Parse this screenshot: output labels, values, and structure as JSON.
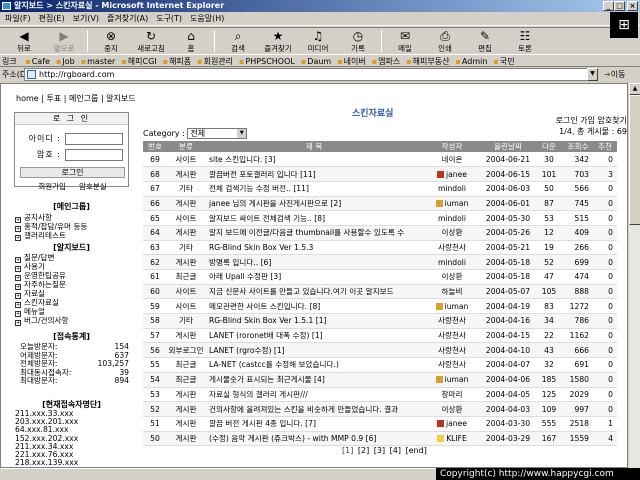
{
  "window": {
    "title": "알지보드 > 스킨자료실 - Microsoft Internet Explorer",
    "min": "_",
    "max": "□",
    "close": "×"
  },
  "menubar": [
    "파일(F)",
    "편집(E)",
    "보기(V)",
    "즐겨찾기(A)",
    "도구(T)",
    "도움말(H)"
  ],
  "toolbar": [
    {
      "label": "뒤로",
      "icon": "back-arrow-icon",
      "glyph": "◀",
      "disabled": false
    },
    {
      "label": "앞으로",
      "icon": "forward-arrow-icon",
      "glyph": "▶",
      "disabled": true
    },
    {
      "label": "중지",
      "icon": "stop-icon",
      "glyph": "⊗",
      "disabled": false
    },
    {
      "label": "새로고침",
      "icon": "refresh-icon",
      "glyph": "↻",
      "disabled": false
    },
    {
      "label": "홈",
      "icon": "home-icon",
      "glyph": "⌂",
      "disabled": false
    },
    {
      "label": "검색",
      "icon": "search-icon",
      "glyph": "⌕",
      "disabled": false
    },
    {
      "label": "즐겨찾기",
      "icon": "favorites-icon",
      "glyph": "★",
      "disabled": false
    },
    {
      "label": "미디어",
      "icon": "media-icon",
      "glyph": "♫",
      "disabled": false
    },
    {
      "label": "기록",
      "icon": "history-icon",
      "glyph": "◷",
      "disabled": false
    },
    {
      "label": "메일",
      "icon": "mail-icon",
      "glyph": "✉",
      "disabled": false
    },
    {
      "label": "인쇄",
      "icon": "print-icon",
      "glyph": "⎙",
      "disabled": false
    },
    {
      "label": "편집",
      "icon": "edit-icon",
      "glyph": "✎",
      "disabled": false
    },
    {
      "label": "토론",
      "icon": "discuss-icon",
      "glyph": "☷",
      "disabled": false
    }
  ],
  "links": [
    "Cafe",
    "Job",
    "master",
    "해피CGI",
    "해피폼",
    "회원관리",
    "PHPSCHOOL",
    "Daum",
    "네이버",
    "엠파스",
    "해피부동산",
    "Admin",
    "국민"
  ],
  "address": {
    "label": "주소(D)",
    "url": "http://rgboard.com",
    "go": "이동"
  },
  "breadcrumb": "home | 투표 | 메인그룹 | 알지보드",
  "page_title": "스킨자료실",
  "login": {
    "header": "로 그 인",
    "id_label": "아이디 :",
    "pw_label": "암호 :",
    "button": "로그인",
    "join": "회원가입",
    "find": "암호분실"
  },
  "right_links": {
    "line1": "로그인 가입 암호찾기",
    "line2": "1/4, 총 게시물 : 69"
  },
  "category": {
    "label": "Category :",
    "value": "전체"
  },
  "main_group": {
    "header": "[메인그룹]",
    "items": [
      "공지사항",
      "홍적/잡담/유머 등등",
      "갤러리테스트"
    ]
  },
  "rg_board": {
    "header": "[알지보드]",
    "items": [
      "질문/답변",
      "사용기",
      "운영한팁공유",
      "자주하는질문",
      "자료실",
      "스킨자료실",
      "메뉴얼",
      "버그/건의사항"
    ]
  },
  "stats": {
    "header": "[접속통계]",
    "rows": [
      {
        "k": "오늘방문자:",
        "v": "154"
      },
      {
        "k": "어제방문자:",
        "v": "637"
      },
      {
        "k": "전체방문자:",
        "v": "103,257"
      },
      {
        "k": "최대동시접속자:",
        "v": "39"
      },
      {
        "k": "최대방문자:",
        "v": "894"
      }
    ]
  },
  "ips": {
    "header": "[현재접속자명단]",
    "items": [
      "211.xxx.33.xxx",
      "203.xxx.201.xxx",
      "64.xxx.81.xxx",
      "152.xxx.202.xxx",
      "211.xxx.34.xxx",
      "221.xxx.76.xxx",
      "218.xxx.139.xxx"
    ]
  },
  "table": {
    "headers": [
      "번호",
      "분류",
      "제 목",
      "작성자",
      "올린날짜",
      "다운",
      "조회수",
      "추천"
    ],
    "rows": [
      [
        "69",
        "사이트",
        "site 스킨입니다. [3]",
        "네이온",
        "2004-06-21",
        "30",
        "342",
        "0"
      ],
      [
        "68",
        "게시판",
        "깔끔버전 포토갤러리 입니다 [11]",
        "janee",
        "2004-06-15",
        "101",
        "703",
        "3"
      ],
      [
        "67",
        "기타",
        "전체 검색기능 수정 버전.. [11]",
        "mindoli",
        "2004-06-03",
        "50",
        "566",
        "0"
      ],
      [
        "66",
        "게시판",
        "janee 님의 게시판을 사진게시판으로 [2]",
        "iuman",
        "2004-06-01",
        "87",
        "745",
        "0"
      ],
      [
        "65",
        "사이트",
        "알지보드 싸이트 전체검색 기능.. [8]",
        "mindoli",
        "2004-05-30",
        "53",
        "515",
        "0"
      ],
      [
        "64",
        "게시판",
        "알지 보드에 이전글/다음글 thumbnail를 사용할수 있도록 수",
        "이상환",
        "2004-05-26",
        "12",
        "409",
        "0"
      ],
      [
        "63",
        "기타",
        "RG-Blind Skin Box Ver 1.5.3",
        "사랑천사",
        "2004-05-21",
        "19",
        "266",
        "0"
      ],
      [
        "62",
        "게시판",
        "방명록 입니다.. [6]",
        "mindoli",
        "2004-05-18",
        "52",
        "699",
        "0"
      ],
      [
        "61",
        "최근글",
        "아래 Upall 수정판 [3]",
        "이상환",
        "2004-05-18",
        "47",
        "474",
        "0"
      ],
      [
        "60",
        "사이트",
        "지금 신문사 사이트를 만들고 있습니다.여기 이곳 알지보드",
        "하늘비",
        "2004-05-07",
        "105",
        "888",
        "0"
      ],
      [
        "59",
        "사이트",
        "메모관련한 사이트 스킨입니다. [8]",
        "iuman",
        "2004-04-19",
        "83",
        "1272",
        "0"
      ],
      [
        "58",
        "기타",
        "RG-Blind Skin Box Ver 1.5.1 [1]",
        "사랑천사",
        "2004-04-16",
        "34",
        "786",
        "0"
      ],
      [
        "57",
        "게시판",
        "LANET (roronet배 대폭 수정) [1]",
        "사랑천사",
        "2004-04-15",
        "22",
        "1162",
        "0"
      ],
      [
        "56",
        "외부로그인",
        "LANET (rgro수정) [1]",
        "사랑천사",
        "2004-04-10",
        "43",
        "666",
        "0"
      ],
      [
        "55",
        "최근글",
        "LA-NET (castcc를 수정해 보았습니다.)",
        "사랑천사",
        "2004-04-07",
        "32",
        "691",
        "0"
      ],
      [
        "54",
        "최근글",
        "게시물숫가 표시되는 최근게시물 [4]",
        "iuman",
        "2004-04-06",
        "185",
        "1580",
        "0"
      ],
      [
        "53",
        "게시판",
        "자료실 형식의 갤러리 게시판///",
        "창마리",
        "2004-04-05",
        "125",
        "2029",
        "0"
      ],
      [
        "52",
        "게시판",
        "건의사항에 올려져있는 스킨을 비숫하게 만들었습니다. 결과",
        "이상환",
        "2004-04-03",
        "109",
        "997",
        "0"
      ],
      [
        "51",
        "게시판",
        "깔끔 버전 게시판 4종 입니다. [7]",
        "janee",
        "2004-03-30",
        "555",
        "2518",
        "1"
      ],
      [
        "50",
        "게시판",
        "(수정) 음악 게시판 (쥬크박스) - with MMP 0.9 [6]",
        "KLIFE",
        "2004-03-29",
        "167",
        "1559",
        "4"
      ]
    ],
    "user_icons": {
      "janee": "#c03020",
      "iuman": "#d8a030",
      "KLIFE": "#f0d040"
    }
  },
  "pager": {
    "current": "[1]",
    "others": "[2] [3] [4] [end]"
  },
  "copyright": "Copyright(c) http://www.happycgi.com"
}
